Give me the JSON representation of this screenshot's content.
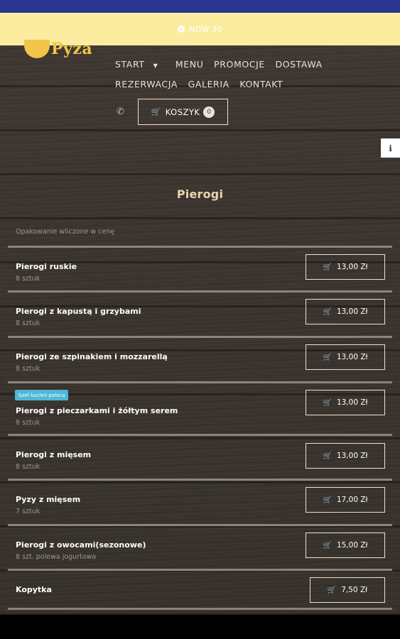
{
  "notice": {
    "text": "NOW 30"
  },
  "logo": {
    "text": "Pyza"
  },
  "nav": {
    "items": [
      "START",
      "MENU",
      "PROMOCJE",
      "DOSTAWA",
      "REZERWACJA",
      "GALERIA",
      "KONTAKT"
    ]
  },
  "cart": {
    "label": "KOSZYK",
    "count": "0"
  },
  "section": {
    "title": "Pierogi",
    "packaging_note": "Opakowanie wliczone w cenę"
  },
  "menu_items": [
    {
      "name": "Pierogi ruskie",
      "desc": "8 sztuk",
      "price": "13,00 Zł",
      "badge": ""
    },
    {
      "name": "Pierogi z kapustą i grzybami",
      "desc": "8 sztuk",
      "price": "13,00 Zł",
      "badge": ""
    },
    {
      "name": "Pierogi ze szpinakiem i mozzarellą",
      "desc": "8 sztuk",
      "price": "13,00 Zł",
      "badge": ""
    },
    {
      "name": "Pierogi z pieczarkami i żółtym serem",
      "desc": "8 sztuk",
      "price": "13,00 Zł",
      "badge": "Szef kuchni poleca"
    },
    {
      "name": "Pierogi z mięsem",
      "desc": "8 sztuk",
      "price": "13,00 Zł",
      "badge": ""
    },
    {
      "name": "Pyzy z mięsem",
      "desc": "7 sztuk",
      "price": "17,00 Zł",
      "badge": ""
    },
    {
      "name": "Pierogi z owocami(sezonowe)",
      "desc": "8 szt. polewa jogurtowa",
      "price": "15,00 Zł",
      "badge": ""
    },
    {
      "name": "Kopytka",
      "desc": "",
      "price": "7,50 Zł",
      "badge": ""
    }
  ],
  "colors": {
    "statusbar": "#283593",
    "notice_bg": "#fcec9f",
    "badge": "#4fb8d6",
    "title": "#e8d6b3",
    "logo": "#f0c54a"
  }
}
